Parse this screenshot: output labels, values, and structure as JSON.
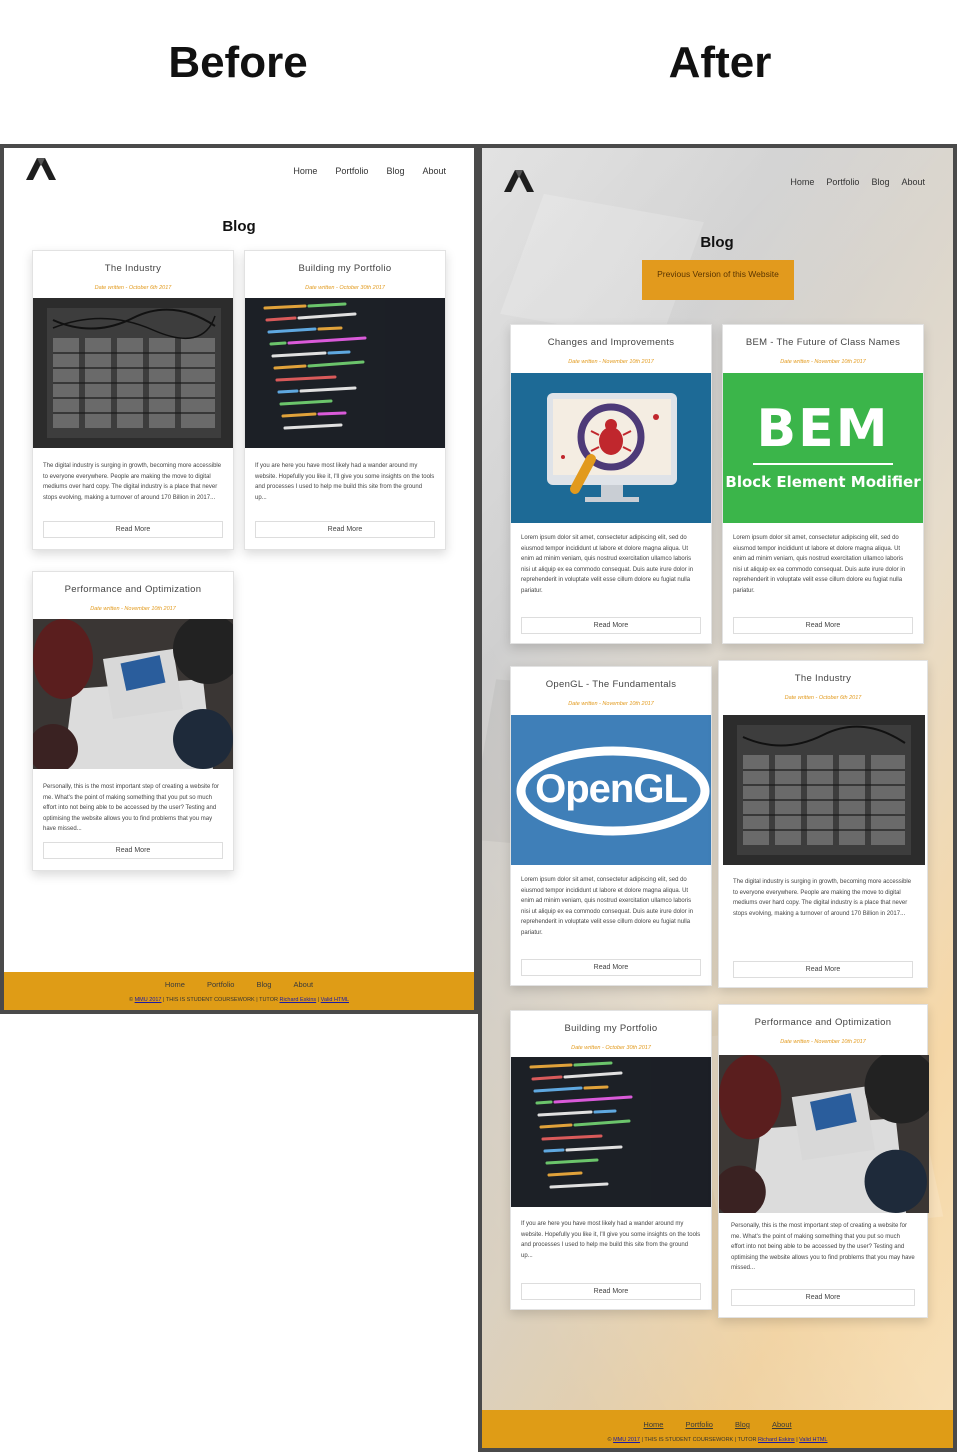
{
  "headings": {
    "before": "Before",
    "after": "After"
  },
  "nav": {
    "home": "Home",
    "portfolio": "Portfolio",
    "blog": "Blog",
    "about": "About"
  },
  "page_title": "Blog",
  "prev_version_button": "Previous Version of this Website",
  "read_more": "Read More",
  "footer": {
    "copy_prefix": "©",
    "mmu": "MMU 2017",
    "middle": "| THIS IS STUDENT COURSEWORK | TUTOR",
    "tutor": "Richard Eskins",
    "sep": "|",
    "valid": "Valid HTML"
  },
  "texts": {
    "industry": "The digital industry is surging in growth, becoming more accessible to everyone everywhere. People are making the move to digital mediums over hard copy. The digital industry is a place that never stops evolving, making a turnover of around 170 Billion in 2017...",
    "portfolio": "If you are here you have most likely had a wander around my website. Hopefully you like it, I'll give you some insights on the tools and processes I used to help me build this site from the ground up...",
    "performance": "Personally, this is the most important step of creating a website for me. What's the point of making something that you put so much effort into not being able to be accessed by the user? Testing and optimising the website allows you to find problems that you may have missed...",
    "lorem": "Lorem ipsum dolor sit amet, consectetur adipiscing elit, sed do eiusmod tempor incididunt ut labore et dolore magna aliqua. Ut enim ad minim veniam, quis nostrud exercitation ullamco laboris nisi ut aliquip ex ea commodo consequat. Duis aute irure dolor in reprehenderit in voluptate velit esse cillum dolore eu fugiat nulla pariatur."
  },
  "posts": {
    "industry": {
      "title": "The Industry",
      "date": "Date written - October 6th 2017"
    },
    "portfolio": {
      "title": "Building my Portfolio",
      "date": "Date written - October 30th 2017"
    },
    "performance": {
      "title": "Performance and Optimization",
      "date": "Date written - November 10th 2017"
    },
    "changes": {
      "title": "Changes and Improvements",
      "date": "Date written - November 10th 2017"
    },
    "bem": {
      "title": "BEM - The Future of Class Names",
      "date": "Date written - November 10th 2017"
    },
    "opengl": {
      "title": "OpenGL - The Fundamentals",
      "date": "Date written - November 10th 2017"
    }
  },
  "image_text": {
    "bem_big": "BEM",
    "bem_sub": "Block Element Modifier",
    "opengl": "OpenGL"
  },
  "colors": {
    "accent": "#e29a1d",
    "footer": "#df9c16",
    "bem_green": "#3bb54a",
    "opengl_blue": "#3f7fb8",
    "bug_bg": "#1d6a96"
  }
}
